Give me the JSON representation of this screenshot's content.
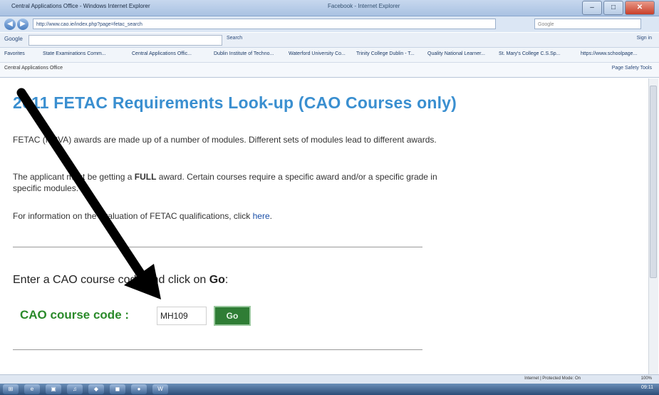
{
  "browser": {
    "window_title": "Central Applications Office - Windows Internet Explorer",
    "window_title_center": "Facebook - Internet Explorer",
    "address": "http://www.cao.ie/index.php?page=fetac_search",
    "search_placeholder": "Google",
    "google_label": "Google",
    "google_search_label": "Search",
    "google_right": "Sign in",
    "favorites": [
      "Favorites",
      "State Examinations Comm...",
      "Central Applications Offic...",
      "Dublin Institute of Techno...",
      "Waterford University Co...",
      "Trinity College Dublin - T...",
      "Quality National Learner...",
      "St. Mary's College C.S.Sp...",
      "https://www.schoolpage..."
    ],
    "tab_title": "Central Applications Office",
    "tools": "Page  Safety  Tools",
    "status_zone": "Internet | Protected Mode: On",
    "zoom": "100%",
    "clock": "09:11"
  },
  "page": {
    "title": "2011 FETAC Requirements Look-up (CAO Courses only)",
    "para1": "FETAC (NCVA) awards are made up of a number of modules. Different sets of modules lead to different awards.",
    "para2_before": "The applicant must be getting a ",
    "para2_bold": "FULL",
    "para2_after": " award. Certain courses require a specific award and/or a specific grade in specific modules.",
    "para3_before": "For information on the evaluation of FETAC qualifications, click ",
    "para3_link": "here",
    "para3_after": ".",
    "enter_before": "Enter a CAO course code and click on ",
    "enter_bold": "Go",
    "enter_after": ":",
    "code_label": "CAO course code :",
    "code_value": "MH109",
    "go_label": "Go"
  },
  "colors": {
    "title": "#3a8fd0",
    "code_label": "#2a8a2a",
    "go_button": "#2f7d35",
    "arrow": "#000000"
  },
  "icons": [
    "back-icon",
    "forward-icon",
    "arrow-pointer-icon"
  ]
}
